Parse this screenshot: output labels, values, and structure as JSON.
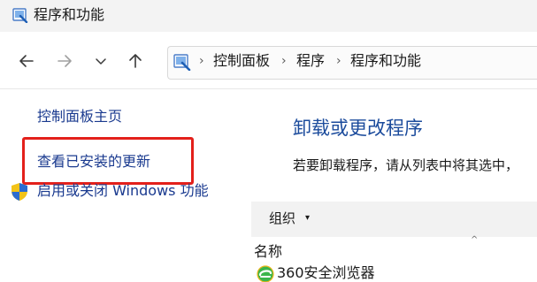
{
  "window": {
    "title": "程序和功能"
  },
  "navigation": {
    "back_icon": "arrow-left-icon",
    "forward_icon": "arrow-right-icon",
    "recent_icon": "chevron-down-icon",
    "up_icon": "arrow-up-icon"
  },
  "address_bar": {
    "icon": "control-panel-icon",
    "separator": "›",
    "crumbs": [
      "控制面板",
      "程序",
      "程序和功能"
    ]
  },
  "left_pane": {
    "links": [
      "控制面板主页",
      "查看已安装的更新",
      "启用或关闭 Windows 功能"
    ],
    "highlight_color": "#e3201b",
    "shield_icon": "uac-shield-icon"
  },
  "main": {
    "title": "卸载或更改程序",
    "description": "若要卸载程序，请从列表中将其选中，",
    "toolbar": {
      "organize_label": "组织",
      "organize_caret": "▾"
    },
    "list": {
      "column_name": "名称",
      "sort_indicator": "^",
      "rows": [
        {
          "name": "360安全浏览器",
          "icon": "360-browser-icon"
        }
      ]
    }
  },
  "colors": {
    "link": "#1a3a8f",
    "heading": "#1b4b9c",
    "titlebar_bg": "#f3f3f3"
  }
}
